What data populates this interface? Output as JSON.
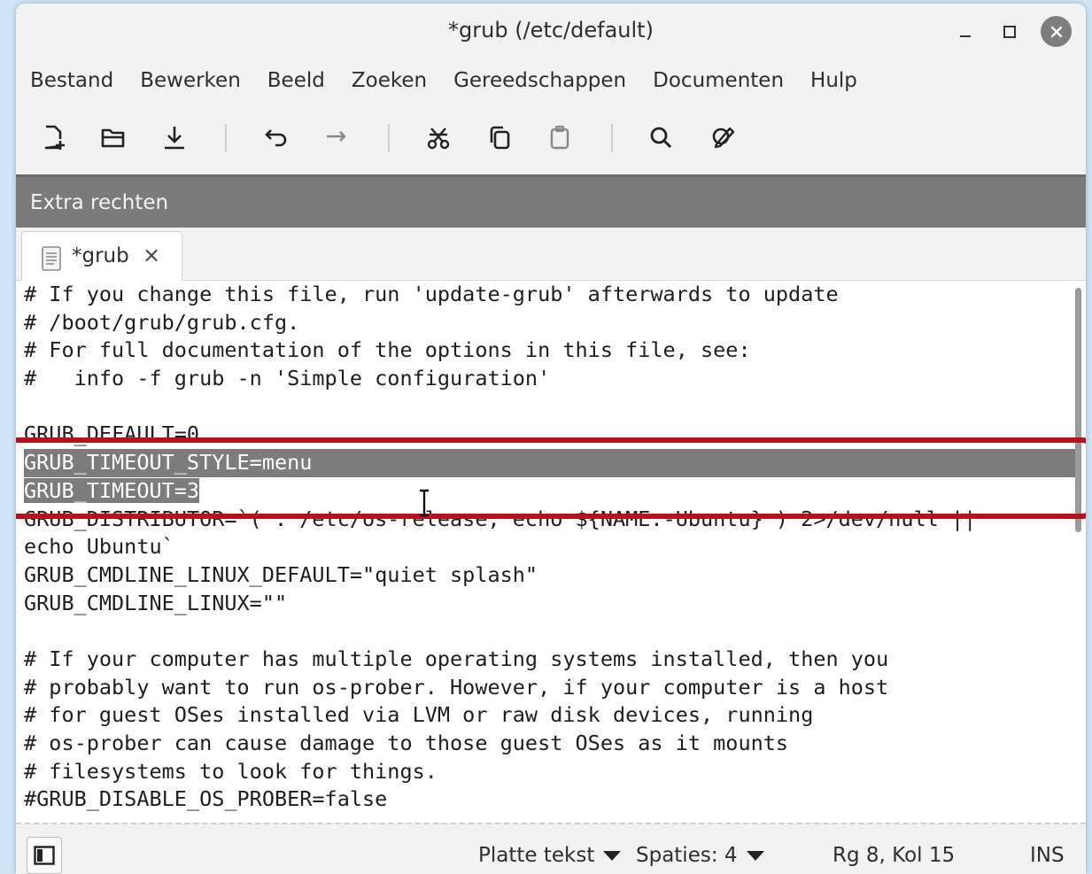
{
  "window": {
    "title": "*grub (/etc/default)",
    "controls": {
      "minimize": "–",
      "maximize": "☐",
      "close": "✕"
    }
  },
  "menu": [
    "Bestand",
    "Bewerken",
    "Beeld",
    "Zoeken",
    "Gereedschappen",
    "Documenten",
    "Hulp"
  ],
  "toolbar": {
    "icons": [
      "new-document-icon",
      "open-folder-icon",
      "save-download-icon",
      "undo-icon",
      "redo-icon",
      "cut-icon",
      "copy-icon",
      "paste-icon",
      "search-icon",
      "replace-icon"
    ]
  },
  "infobar": {
    "label": "Extra rechten"
  },
  "tab": {
    "label": "*grub",
    "close": "×"
  },
  "editor": {
    "lines": [
      "# If you change this file, run 'update-grub' afterwards to update",
      "# /boot/grub/grub.cfg.",
      "# For full documentation of the options in this file, see:",
      "#   info -f grub -n 'Simple configuration'",
      "",
      "GRUB_DEFAULT=0",
      "GRUB_TIMEOUT_STYLE=menu",
      "GRUB_TIMEOUT=3",
      "GRUB_DISTRIBUTOR=`( . /etc/os-release; echo ${NAME:-Ubuntu} ) 2>/dev/null ||",
      "echo Ubuntu`",
      "GRUB_CMDLINE_LINUX_DEFAULT=\"quiet splash\"",
      "GRUB_CMDLINE_LINUX=\"\"",
      "",
      "# If your computer has multiple operating systems installed, then you",
      "# probably want to run os-prober. However, if your computer is a host",
      "# for guest OSes installed via LVM or raw disk devices, running",
      "# os-prober can cause damage to those guest OSes as it mounts",
      "# filesystems to look for things.",
      "#GRUB_DISABLE_OS_PROBER=false"
    ]
  },
  "statusbar": {
    "language": "Platte tekst",
    "indent": "Spaties: 4",
    "position": "Rg 8, Kol 15",
    "mode": "INS"
  },
  "colors": {
    "highlight_border": "#b5121b",
    "selection": "#7c7c7c",
    "infobar": "#7b7b7b"
  }
}
